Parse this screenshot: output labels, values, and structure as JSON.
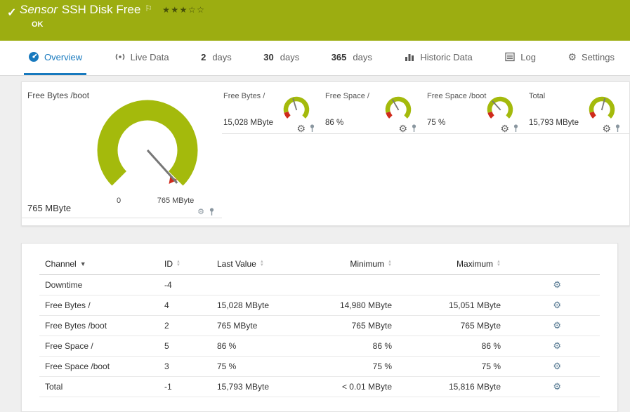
{
  "colors": {
    "green_header": "#9cad11",
    "gauge_green": "#a4ba0c",
    "gauge_red": "#cf2a1b",
    "accent_blue": "#1779be"
  },
  "icons": {
    "gear_glyph": "⚙",
    "check_glyph": "✓",
    "flag_glyph": "⚐",
    "sort_asc_glyph": "▲",
    "sort_desc_glyph": "▼",
    "star_filled": "★",
    "star_empty": "☆"
  },
  "header": {
    "title_prefix": "Sensor",
    "title": "SSH Disk Free",
    "status": "OK",
    "stars_filled": 3,
    "stars_total": 5
  },
  "tabs": [
    {
      "label": "Overview",
      "icon": "overview-icon",
      "active": true
    },
    {
      "label": "Live Data",
      "icon": "live-data-icon"
    },
    {
      "num": "2",
      "label": "days"
    },
    {
      "num": "30",
      "label": "days"
    },
    {
      "num": "365",
      "label": "days"
    },
    {
      "label": "Historic Data",
      "icon": "historic-data-icon"
    },
    {
      "label": "Log",
      "icon": "log-icon"
    },
    {
      "label": "Settings",
      "icon": "settings-icon"
    }
  ],
  "gauge_panel": {
    "primary": {
      "label": "Free Bytes /boot",
      "value": "765 MByte",
      "scale_min": "0",
      "scale_max": "765 MByte",
      "needle_deg": 138
    },
    "minis": [
      {
        "label": "Free Bytes /",
        "value": "15,028 MByte",
        "needle_deg": -17
      },
      {
        "label": "Free Space /",
        "value": "86 %",
        "needle_deg": -30
      },
      {
        "label": "Free Space /boot",
        "value": "75 %",
        "needle_deg": -42
      },
      {
        "label": "Total",
        "value": "15,793 MByte",
        "needle_deg": 15
      }
    ]
  },
  "table": {
    "columns": [
      "Channel",
      "ID",
      "Last Value",
      "Minimum",
      "Maximum"
    ],
    "sort": {
      "column": "Channel",
      "direction": "desc"
    },
    "rows": [
      {
        "channel": "Downtime",
        "id": "-4",
        "last": "",
        "min": "",
        "max": ""
      },
      {
        "channel": "Free Bytes /",
        "id": "4",
        "last": "15,028 MByte",
        "min": "14,980 MByte",
        "max": "15,051 MByte"
      },
      {
        "channel": "Free Bytes /boot",
        "id": "2",
        "last": "765 MByte",
        "min": "765 MByte",
        "max": "765 MByte"
      },
      {
        "channel": "Free Space /",
        "id": "5",
        "last": "86 %",
        "min": "86 %",
        "max": "86 %"
      },
      {
        "channel": "Free Space /boot",
        "id": "3",
        "last": "75 %",
        "min": "75 %",
        "max": "75 %"
      },
      {
        "channel": "Total",
        "id": "-1",
        "last": "15,793 MByte",
        "min": "< 0.01 MByte",
        "max": "15,816 MByte"
      }
    ]
  }
}
